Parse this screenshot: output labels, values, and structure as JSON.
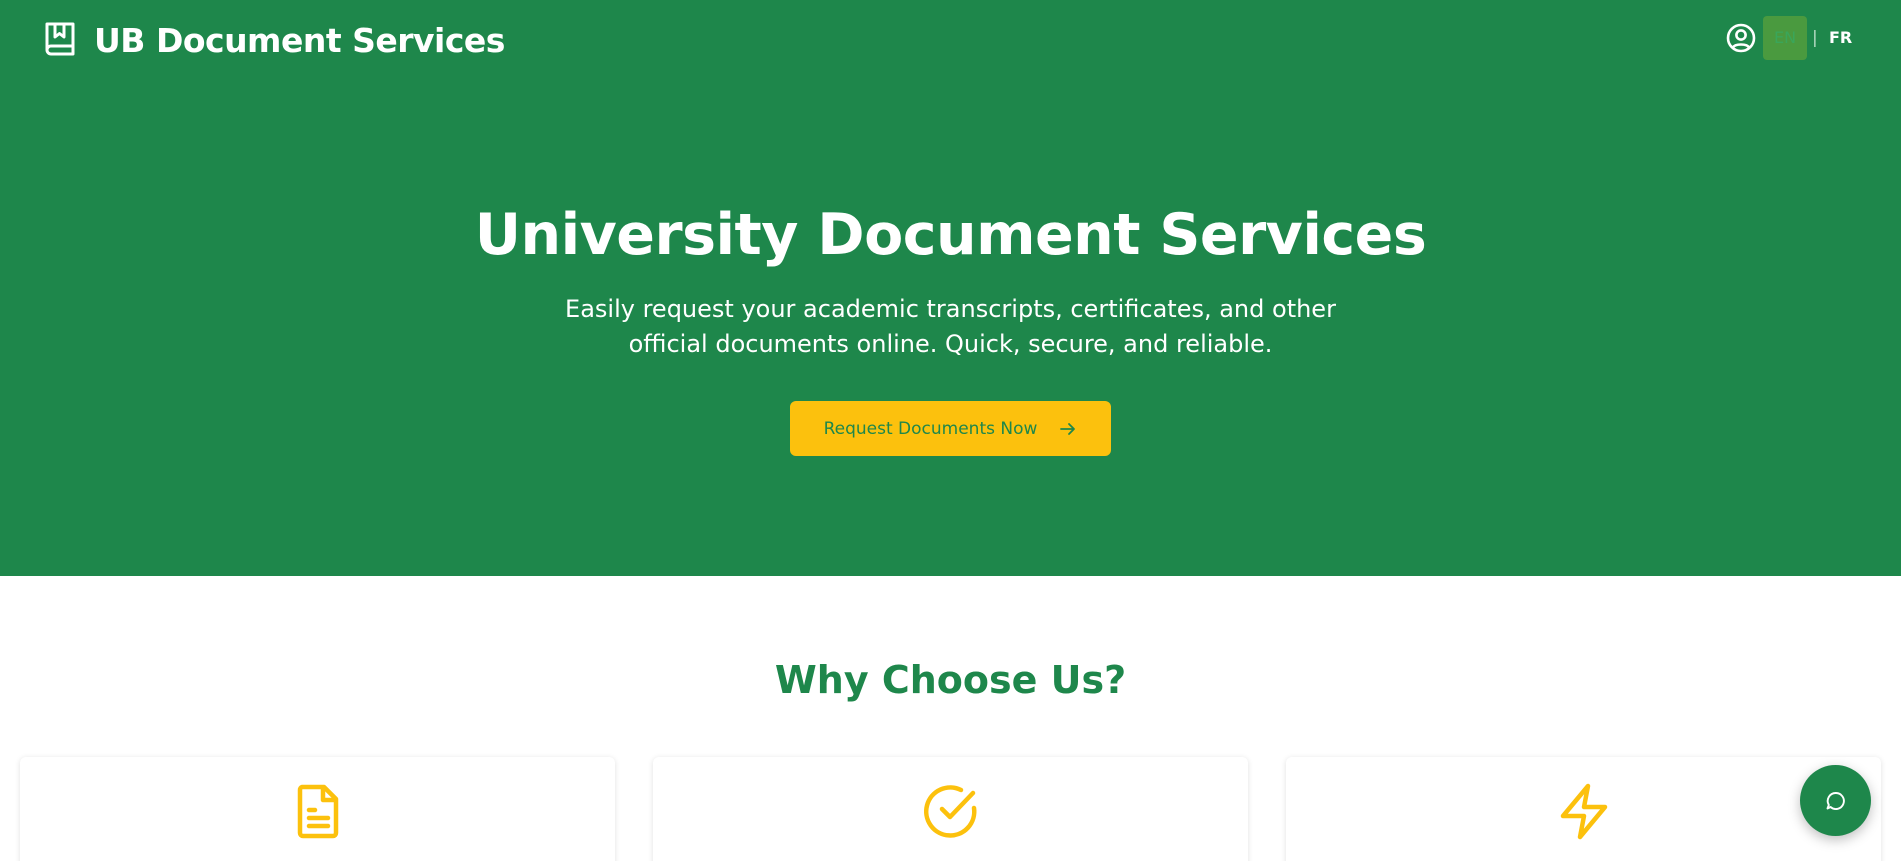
{
  "header": {
    "brand_title": "UB Document Services",
    "brand_icon": "bookmark-book-icon",
    "user_icon": "user-circle-icon",
    "languages": {
      "en": "EN",
      "separator": "|",
      "fr": "FR",
      "active": "EN"
    }
  },
  "hero": {
    "title": "University Document Services",
    "subtitle": "Easily request your academic transcripts, certificates, and other official documents online. Quick, secure, and reliable.",
    "cta_label": "Request Documents Now",
    "cta_icon": "arrow-right-icon"
  },
  "features": {
    "title": "Why Choose Us?",
    "cards": [
      {
        "icon": "document-text-icon"
      },
      {
        "icon": "check-circle-icon"
      },
      {
        "icon": "lightning-icon"
      }
    ]
  },
  "chat": {
    "icon": "chat-bubble-icon"
  },
  "colors": {
    "primary_green": "#1e874b",
    "accent_yellow": "#fcc10d",
    "white": "#ffffff"
  }
}
